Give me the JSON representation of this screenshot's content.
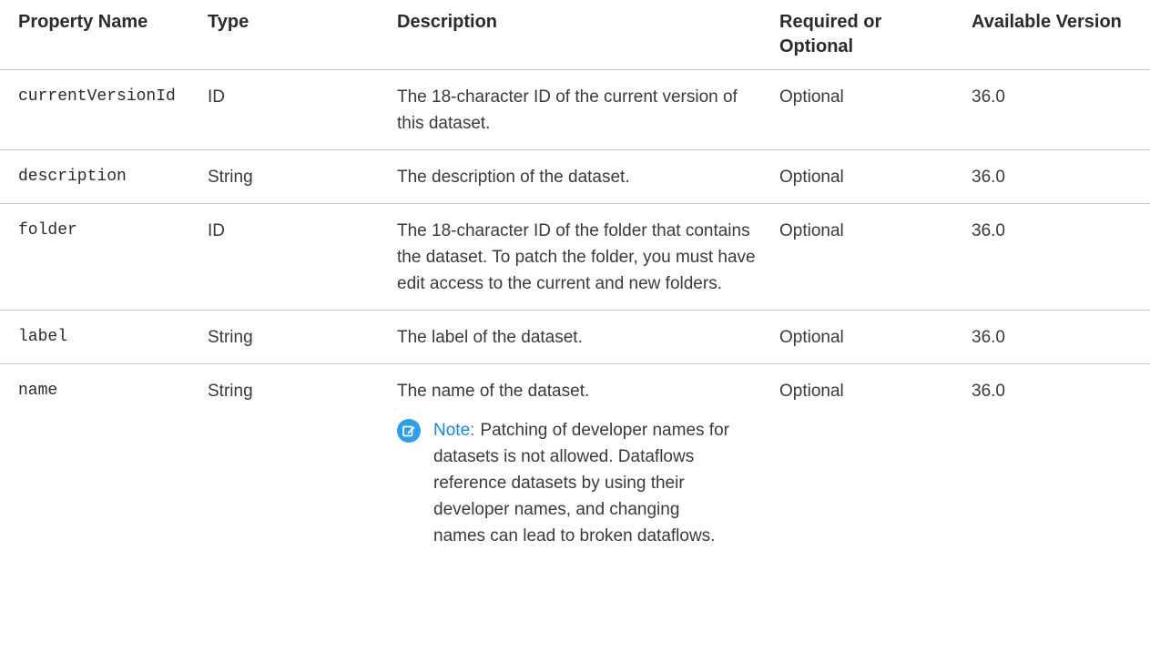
{
  "table": {
    "headers": {
      "property_name": "Property Name",
      "type": "Type",
      "description": "Description",
      "required": "Required or Optional",
      "version": "Available Version"
    },
    "rows": [
      {
        "name": "currentVersionId",
        "type": "ID",
        "description": "The 18-character ID of the current version of this dataset.",
        "required": "Optional",
        "version": "36.0"
      },
      {
        "name": "description",
        "type": "String",
        "description": "The description of the dataset.",
        "required": "Optional",
        "version": "36.0"
      },
      {
        "name": "folder",
        "type": "ID",
        "description": "The 18-character ID of the folder that contains the dataset. To patch the folder, you must have edit access to the current and new folders.",
        "required": "Optional",
        "version": "36.0"
      },
      {
        "name": "label",
        "type": "String",
        "description": "The label of the dataset.",
        "required": "Optional",
        "version": "36.0"
      },
      {
        "name": "name",
        "type": "String",
        "description": "The name of the dataset.",
        "required": "Optional",
        "version": "36.0",
        "note": {
          "icon": "edit-note-icon",
          "label": "Note:",
          "text": "Patching of developer names for datasets is not allowed. Dataflows reference datasets by using their developer names, and changing names can lead to broken dataflows."
        }
      }
    ]
  },
  "colors": {
    "note_icon_bg": "#2f9ee6",
    "note_label": "#1a86d6",
    "rule": "#c9c9c9"
  }
}
